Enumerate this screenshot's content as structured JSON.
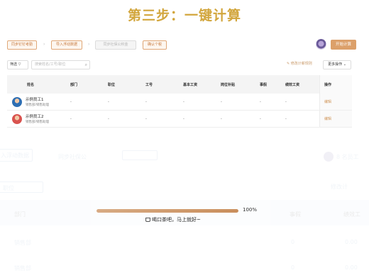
{
  "title": "第三步：一键计算",
  "steps": [
    {
      "label": "同步钉钉考勤",
      "state": "active"
    },
    {
      "label": "导入浮动数据",
      "state": "active"
    },
    {
      "label": "同步社保公积金",
      "state": "disabled"
    },
    {
      "label": "确认个税",
      "state": "active"
    }
  ],
  "start_button": "开始计算",
  "filter": {
    "label": "筛选",
    "search_placeholder": "搜索姓名/工号/职位"
  },
  "modify_rule": "修改计薪规则",
  "more_actions": "更多操作",
  "table": {
    "headers": [
      "姓名",
      "部门",
      "职位",
      "工号",
      "基本工资",
      "岗位补贴",
      "事假",
      "绩效工资",
      "操作"
    ],
    "rows": [
      {
        "name": "示例员工1",
        "dept": "销售部/销售助理",
        "cells": [
          "-",
          "-",
          "-",
          "-",
          "-",
          "-",
          "-"
        ],
        "action": "编辑"
      },
      {
        "name": "示例员工2",
        "dept": "销售部/销售助理",
        "cells": [
          "-",
          "-",
          "-",
          "-",
          "-",
          "-",
          "-"
        ],
        "action": "编辑"
      }
    ]
  },
  "faded_bg": {
    "step_text_1": "入浮动数据",
    "step_text_2": "同步社保公",
    "count_text": "8 名员工",
    "filter_text": "职位",
    "rule_text": "修改计",
    "headers": [
      "部门",
      "事假",
      "绩效工"
    ],
    "rows": [
      {
        "dept": "销售部",
        "v1": "0",
        "v2": "0.00"
      },
      {
        "dept": "销售部",
        "v1": "0",
        "v2": "0.00"
      }
    ]
  },
  "progress": {
    "value": 100,
    "label": "100%",
    "message": "喝口茶吧，马上就好~"
  },
  "colors": {
    "accent": "#d2a63d",
    "brand": "#dca06a",
    "link": "#d09558"
  }
}
